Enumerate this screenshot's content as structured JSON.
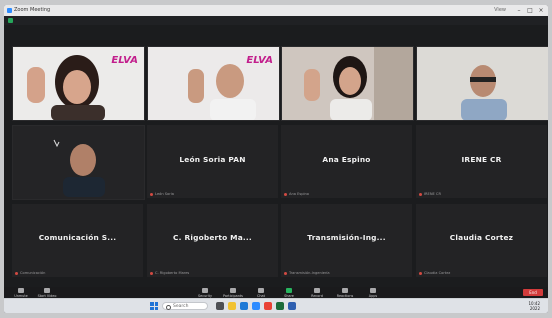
{
  "window": {
    "title": "Zoom Meeting",
    "right_text": "View"
  },
  "participants": [
    {
      "name": "",
      "mini": "",
      "video": true
    },
    {
      "name": "",
      "mini": "",
      "video": true
    },
    {
      "name": "",
      "mini": "",
      "video": true
    },
    {
      "name": "",
      "mini": "",
      "video": true
    },
    {
      "name": "",
      "mini": "",
      "video": true
    },
    {
      "name": "León Soria PAN",
      "mini": "León Soria",
      "video": false
    },
    {
      "name": "Ana Espino",
      "mini": "Ana Espino",
      "video": false
    },
    {
      "name": "IRENE CR",
      "mini": "IRENE CR",
      "video": false
    },
    {
      "name": "Comunicación S...",
      "mini": "Comunicación",
      "video": false
    },
    {
      "name": "C. Rigoberto Ma...",
      "mini": "C. Rigoberto Mares",
      "video": false
    },
    {
      "name": "Transmisión-Ing...",
      "mini": "Transmisión-Ingeniería",
      "video": false
    },
    {
      "name": "Claudia Cortez",
      "mini": "Claudia Cortez",
      "video": false
    }
  ],
  "brand_logo_text": "ELVA",
  "controls": {
    "items": [
      "Unmute",
      "Start Video",
      "Security",
      "Participants",
      "Chat",
      "Share Screen",
      "Record",
      "Reactions",
      "Apps"
    ],
    "end": "End"
  },
  "taskbar": {
    "search_placeholder": "Search",
    "time": "10:42",
    "date": "2022"
  },
  "colors": {
    "screen_bg": "#1b1c1e",
    "tile_bg": "#232325",
    "brand": "#c21e8c",
    "end_red": "#d23b3b"
  }
}
